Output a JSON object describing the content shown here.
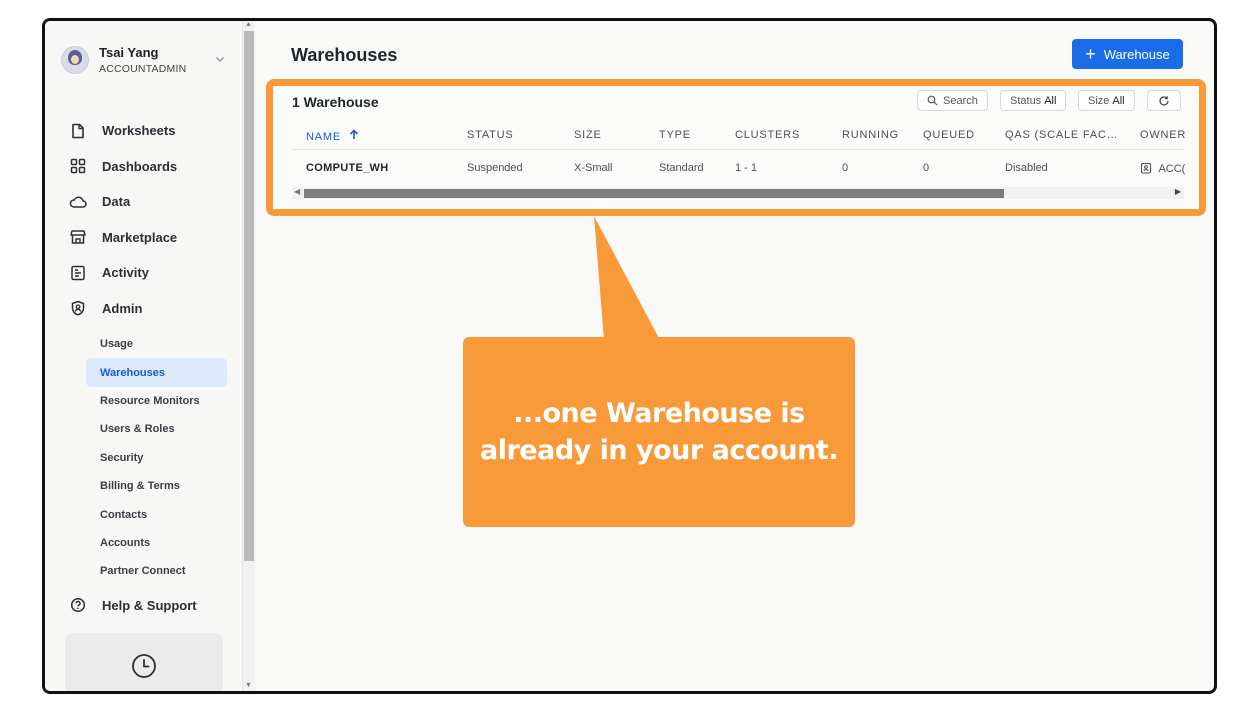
{
  "user": {
    "name": "Tsai Yang",
    "role": "ACCOUNTADMIN"
  },
  "nav": {
    "items": [
      {
        "label": "Worksheets",
        "icon": "worksheet-icon"
      },
      {
        "label": "Dashboards",
        "icon": "dashboard-grid-icon"
      },
      {
        "label": "Data",
        "icon": "cloud-icon"
      },
      {
        "label": "Marketplace",
        "icon": "store-icon"
      },
      {
        "label": "Activity",
        "icon": "activity-list-icon"
      },
      {
        "label": "Admin",
        "icon": "shield-user-icon"
      }
    ],
    "admin_sub": [
      {
        "label": "Usage"
      },
      {
        "label": "Warehouses",
        "active": true
      },
      {
        "label": "Resource Monitors"
      },
      {
        "label": "Users & Roles"
      },
      {
        "label": "Security"
      },
      {
        "label": "Billing & Terms"
      },
      {
        "label": "Contacts"
      },
      {
        "label": "Accounts"
      },
      {
        "label": "Partner Connect"
      }
    ],
    "help": {
      "label": "Help & Support",
      "icon": "question-circle-icon"
    }
  },
  "main": {
    "title": "Warehouses",
    "new_button": "Warehouse",
    "count_label": "1 Warehouse",
    "tools": {
      "search": "Search",
      "status_label": "Status",
      "status_value": "All",
      "size_label": "Size",
      "size_value": "All"
    },
    "columns": [
      "NAME",
      "STATUS",
      "SIZE",
      "TYPE",
      "CLUSTERS",
      "RUNNING",
      "QUEUED",
      "QAS (SCALE FAC…",
      "OWNER"
    ],
    "rows": [
      {
        "name": "COMPUTE_WH",
        "status": "Suspended",
        "size": "X-Small",
        "type": "Standard",
        "clusters": "1 - 1",
        "running": "0",
        "queued": "0",
        "qas": "Disabled",
        "owner": "ACC("
      }
    ]
  },
  "callout": {
    "line1": "...one Warehouse is",
    "line2": "already in your account."
  },
  "colors": {
    "accent": "#1a6ce8",
    "highlight": "#f89a3a",
    "active_nav_bg": "#dce8fb"
  }
}
